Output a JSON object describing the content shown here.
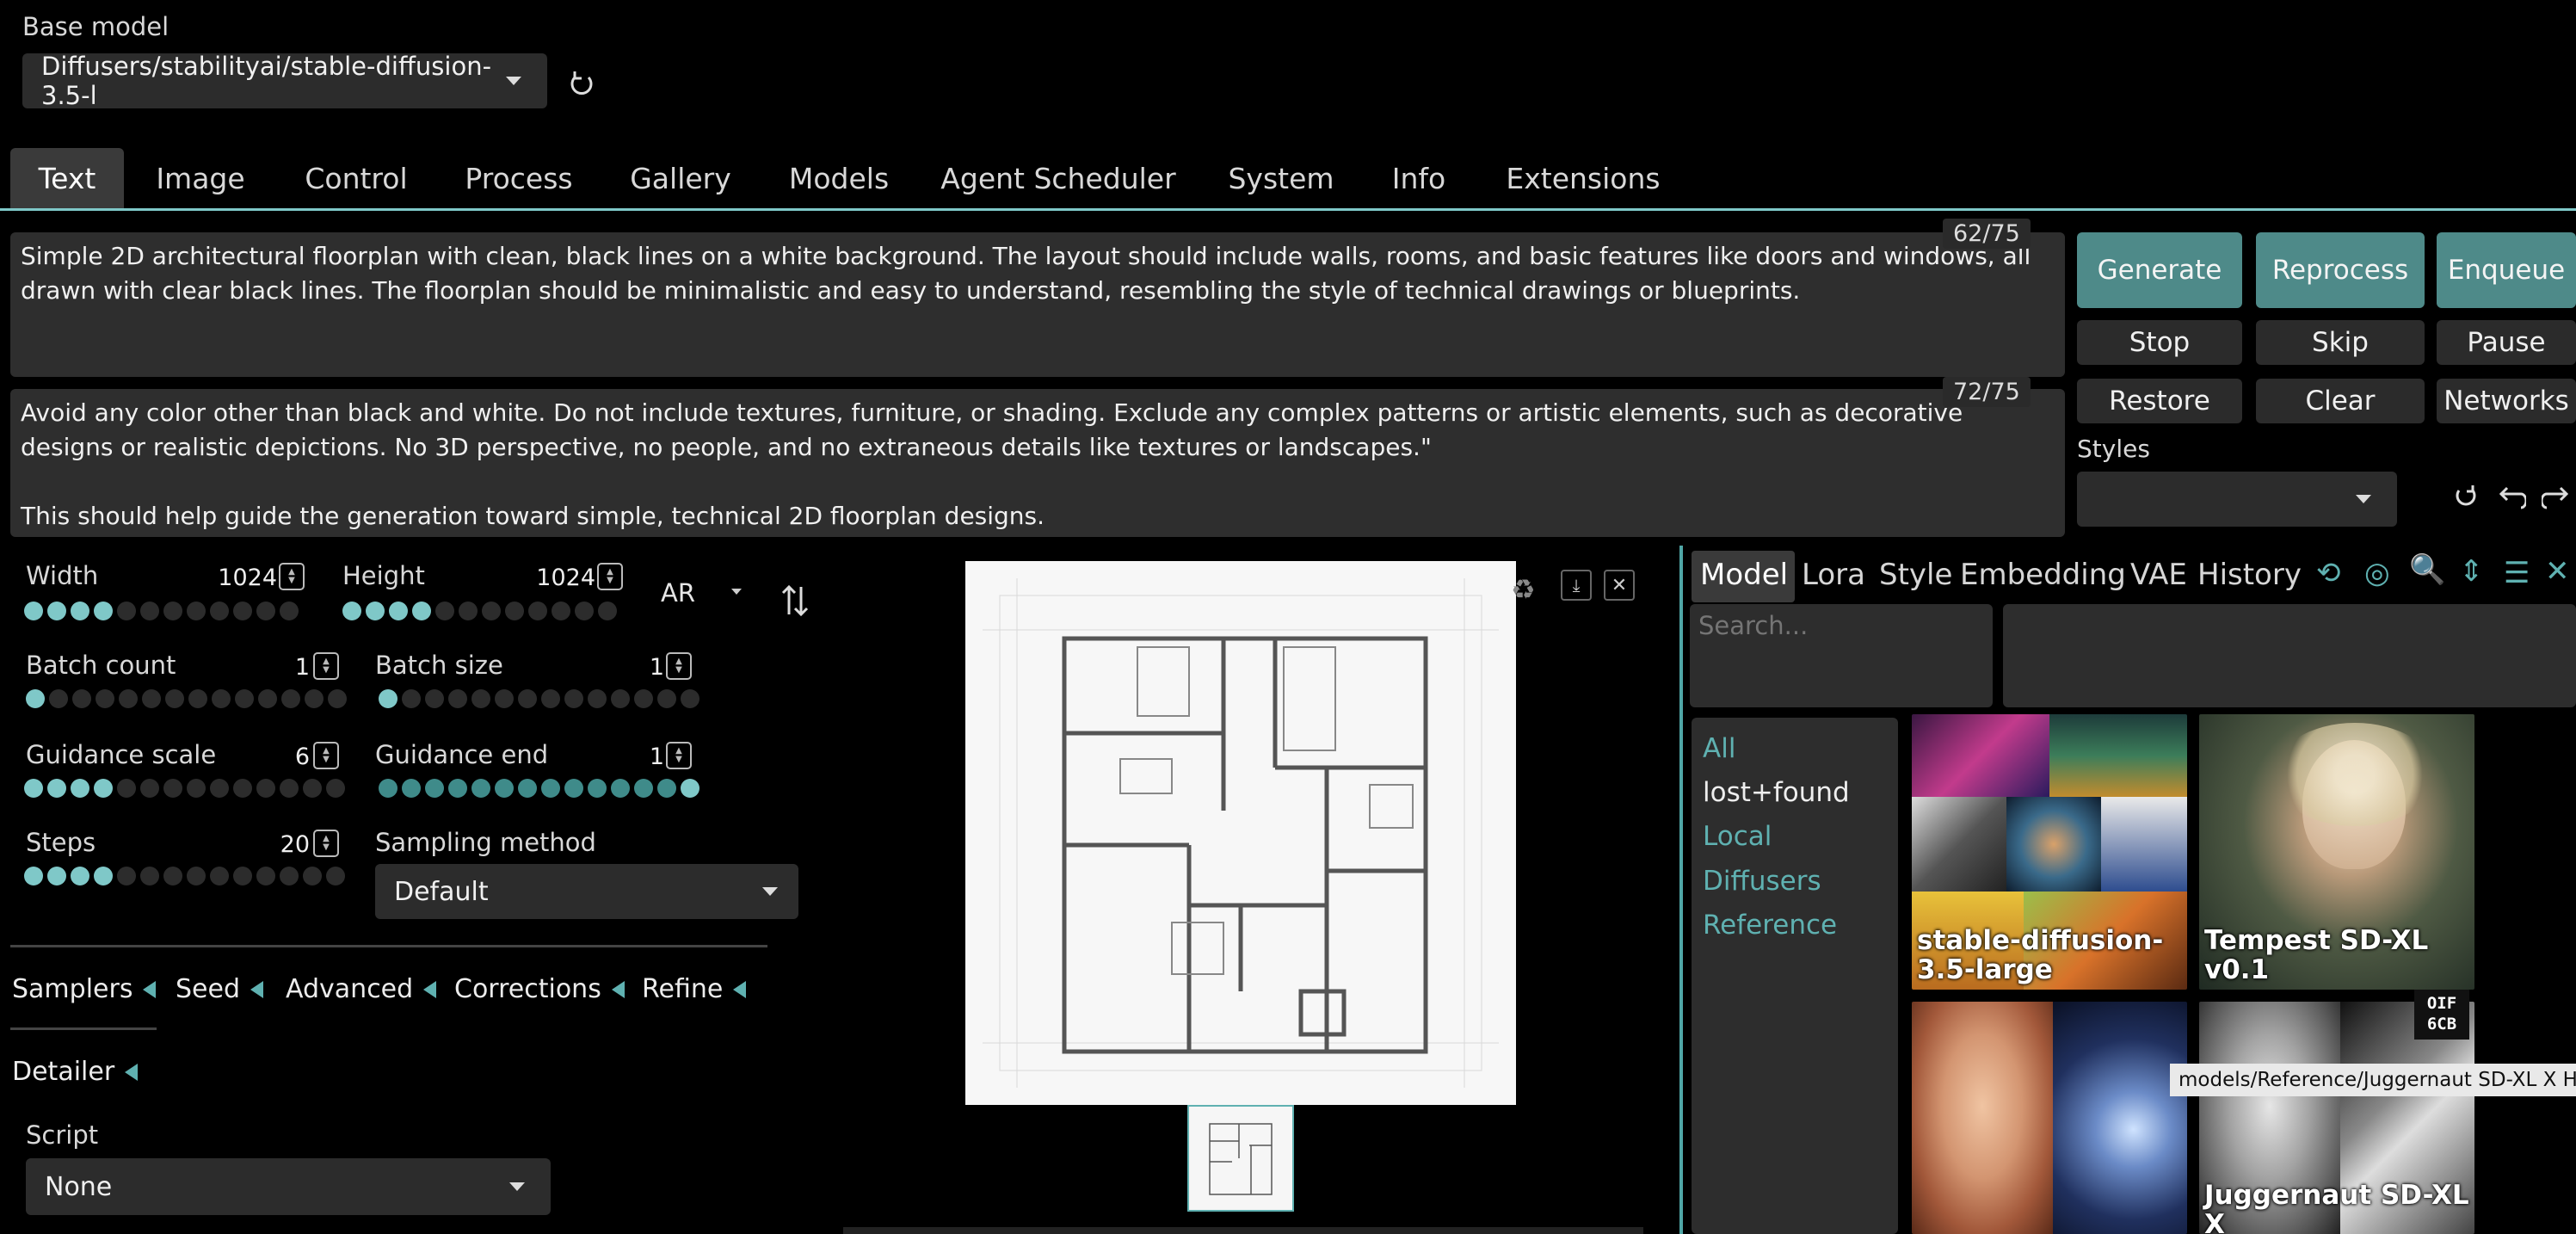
{
  "base_model": {
    "label": "Base model",
    "value": "Diffusers/stabilityai/stable-diffusion-3.5-l"
  },
  "tabs": [
    "Text",
    "Image",
    "Control",
    "Process",
    "Gallery",
    "Models",
    "Agent Scheduler",
    "System",
    "Info",
    "Extensions"
  ],
  "prompt": {
    "text": "Simple 2D architectural floorplan with clean, black lines on a white background. The layout should include walls, rooms, and basic features like doors and windows, all drawn with clear black lines. The floorplan should be minimalistic and easy to understand, resembling the style of technical drawings or blueprints.",
    "counter": "62/75"
  },
  "negative_prompt": {
    "text": "Avoid any color other than black and white. Do not include textures, furniture, or shading. Exclude any complex patterns or artistic elements, such as decorative designs or realistic depictions. No 3D perspective, no people, and no extraneous details like textures or landscapes.\"\n\nThis should help guide the generation toward simple, technical 2D floorplan designs.",
    "counter": "72/75"
  },
  "actions": {
    "generate": "Generate",
    "reprocess": "Reprocess",
    "enqueue": "Enqueue",
    "stop": "Stop",
    "skip": "Skip",
    "pause": "Pause",
    "restore": "Restore",
    "clear": "Clear",
    "networks": "Networks",
    "styles_label": "Styles"
  },
  "params": {
    "width": {
      "label": "Width",
      "value": "1024"
    },
    "height": {
      "label": "Height",
      "value": "1024"
    },
    "ar": "AR",
    "batch_count": {
      "label": "Batch count",
      "value": "1"
    },
    "batch_size": {
      "label": "Batch size",
      "value": "1"
    },
    "guidance_scale": {
      "label": "Guidance scale",
      "value": "6"
    },
    "guidance_end": {
      "label": "Guidance end",
      "value": "1"
    },
    "steps": {
      "label": "Steps",
      "value": "20"
    },
    "sampling_method": {
      "label": "Sampling method",
      "value": "Default"
    }
  },
  "accordions": [
    "Samplers",
    "Seed",
    "Advanced",
    "Corrections",
    "Refine",
    "Detailer"
  ],
  "script": {
    "label": "Script",
    "value": "None"
  },
  "networks": {
    "tabs": [
      "Model",
      "Lora",
      "Style",
      "Embedding",
      "VAE",
      "History"
    ],
    "search_placeholder": "Search...",
    "categories": [
      "All",
      "lost+found",
      "Local",
      "Diffusers",
      "Reference"
    ],
    "cards": [
      {
        "name": "stable-diffusion-3.5-large"
      },
      {
        "name": "Tempest SD-XL v0.1"
      },
      {
        "name": "Juggernaut SD-XL X"
      }
    ],
    "tooltip": "models/Reference/Juggernaut SD-XL X Hyp",
    "badge": "OIF\n6CB"
  },
  "colors": {
    "accent": "#5fb1b1",
    "button_teal": "#4e8a89",
    "panel": "#2d2d2d"
  }
}
